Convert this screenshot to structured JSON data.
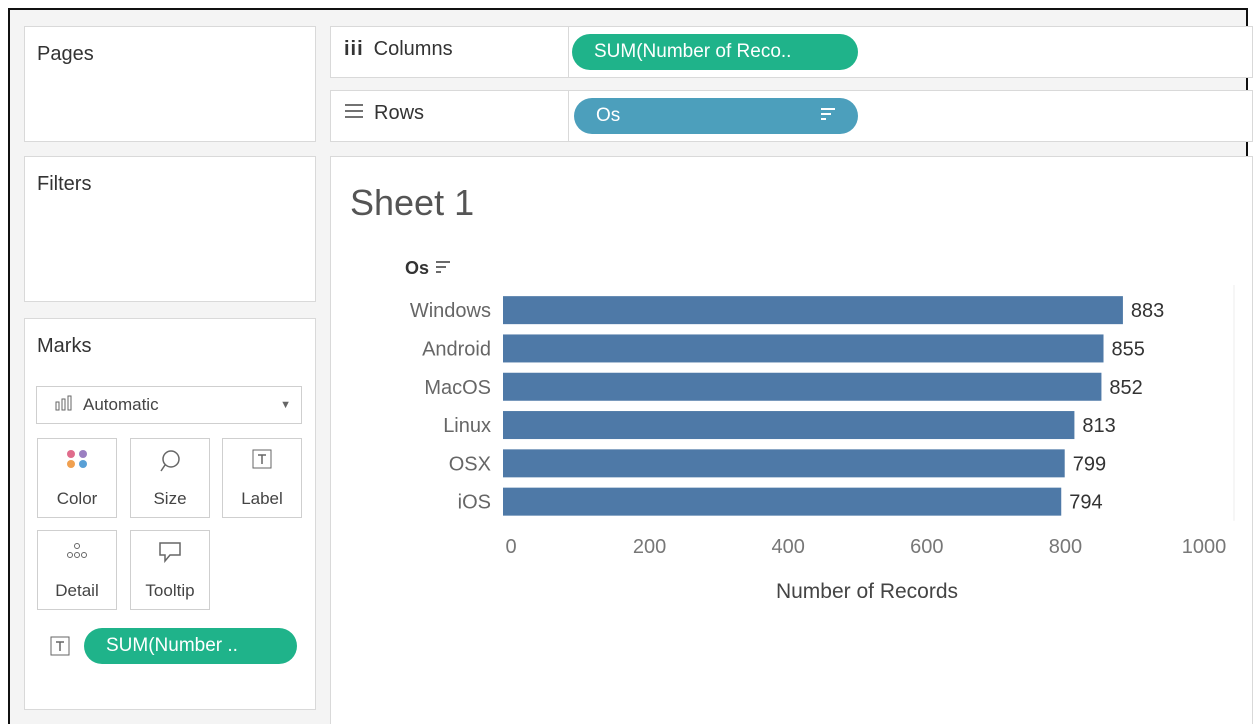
{
  "pages": {
    "title": "Pages"
  },
  "filters": {
    "title": "Filters"
  },
  "marks": {
    "title": "Marks",
    "mark_type": "Automatic",
    "cards": [
      {
        "label": "Color",
        "icon": "color-dots-icon"
      },
      {
        "label": "Size",
        "icon": "size-lasso-icon"
      },
      {
        "label": "Label",
        "icon": "text-box-icon"
      },
      {
        "label": "Detail",
        "icon": "detail-dots-icon"
      },
      {
        "label": "Tooltip",
        "icon": "speech-bubble-icon"
      }
    ],
    "label_pill": "SUM(Number .."
  },
  "shelves": {
    "columns_label": "Columns",
    "rows_label": "Rows",
    "columns_pill": "SUM(Number of Reco..",
    "rows_pill": "Os"
  },
  "sheet": {
    "title": "Sheet 1",
    "row_header": "Os"
  },
  "colors": {
    "bar": "#4e79a7",
    "green_pill": "#1fb38a",
    "blue_pill": "#4c9fbc"
  },
  "chart_data": {
    "type": "bar",
    "orientation": "horizontal",
    "categories": [
      "Windows",
      "Android",
      "MacOS",
      "Linux",
      "OSX",
      "iOS"
    ],
    "values": [
      883,
      855,
      852,
      813,
      799,
      794
    ],
    "data_labels": [
      "883",
      "855",
      "852",
      "813",
      "799",
      "794"
    ],
    "xlabel": "Number of Records",
    "ylabel": "Os",
    "xlim": [
      0,
      1000
    ],
    "xticks": [
      0,
      200,
      400,
      600,
      800,
      1000
    ],
    "xtick_labels": [
      "0",
      "200",
      "400",
      "600",
      "800",
      "1000"
    ]
  }
}
